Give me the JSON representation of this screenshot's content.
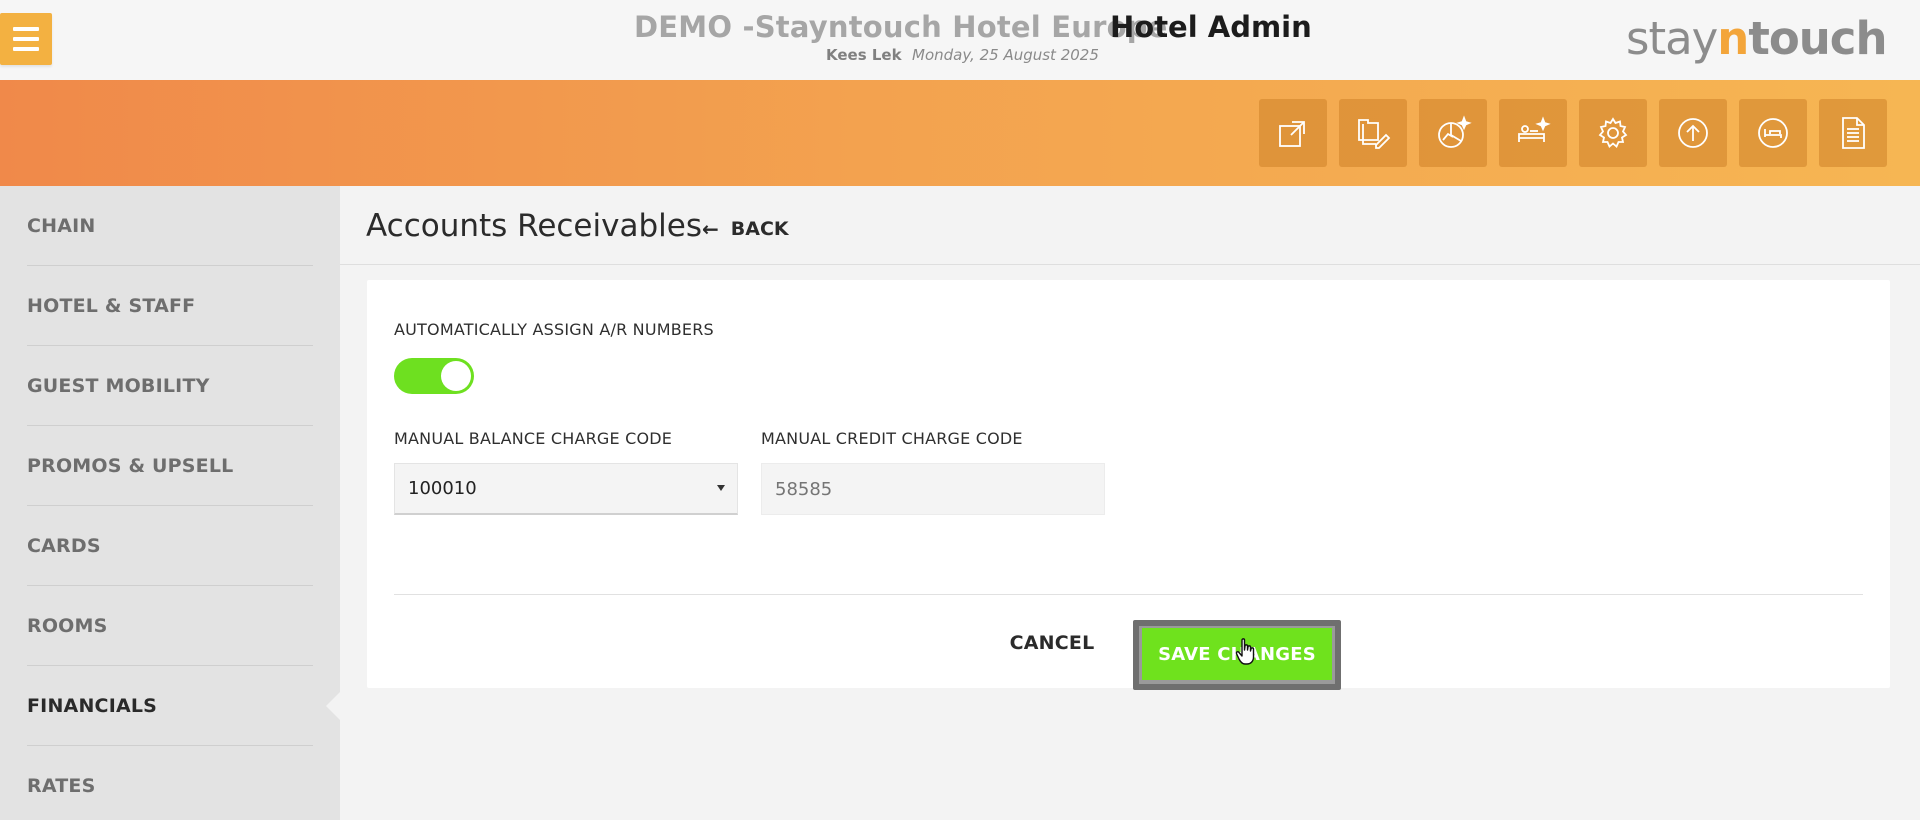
{
  "header": {
    "hotel_name": "DEMO -Stayntouch Hotel Europe",
    "app_name": "Hotel Admin",
    "user": "Kees Lek",
    "date": "Monday, 25 August 2025",
    "logo": {
      "part1": "stay",
      "part2": "n",
      "part3": "touch"
    },
    "menu_icon": "hamburger-icon"
  },
  "action_bar": {
    "buttons": [
      {
        "icon": "external-link-icon"
      },
      {
        "icon": "edit-documents-icon"
      },
      {
        "icon": "analytics-sparkle-icon"
      },
      {
        "icon": "housekeeping-icon"
      },
      {
        "icon": "settings-gear-icon"
      },
      {
        "icon": "upload-icon"
      },
      {
        "icon": "bed-icon"
      },
      {
        "icon": "document-icon"
      }
    ]
  },
  "sidebar": {
    "items": [
      {
        "label": "CHAIN",
        "active": false
      },
      {
        "label": "HOTEL & STAFF",
        "active": false
      },
      {
        "label": "GUEST MOBILITY",
        "active": false
      },
      {
        "label": "PROMOS & UPSELL",
        "active": false
      },
      {
        "label": "CARDS",
        "active": false
      },
      {
        "label": "ROOMS",
        "active": false
      },
      {
        "label": "FINANCIALS",
        "active": true
      },
      {
        "label": "RATES",
        "active": false
      }
    ]
  },
  "main": {
    "title": "Accounts Receivables",
    "back_label": "BACK",
    "back_icon": "arrow-left-icon",
    "form": {
      "auto_assign_label": "AUTOMATICALLY ASSIGN A/R NUMBERS",
      "auto_assign_on": true,
      "balance_code_label": "MANUAL BALANCE CHARGE CODE",
      "balance_code_value": "100010",
      "credit_code_label": "MANUAL CREDIT CHARGE CODE",
      "credit_code_placeholder": "58585",
      "cancel_label": "CANCEL",
      "save_label": "SAVE CHANGES"
    }
  },
  "colors": {
    "accent_orange": "#f3a24f",
    "toggle_green": "#6ee020",
    "save_green": "#6fe21d"
  }
}
